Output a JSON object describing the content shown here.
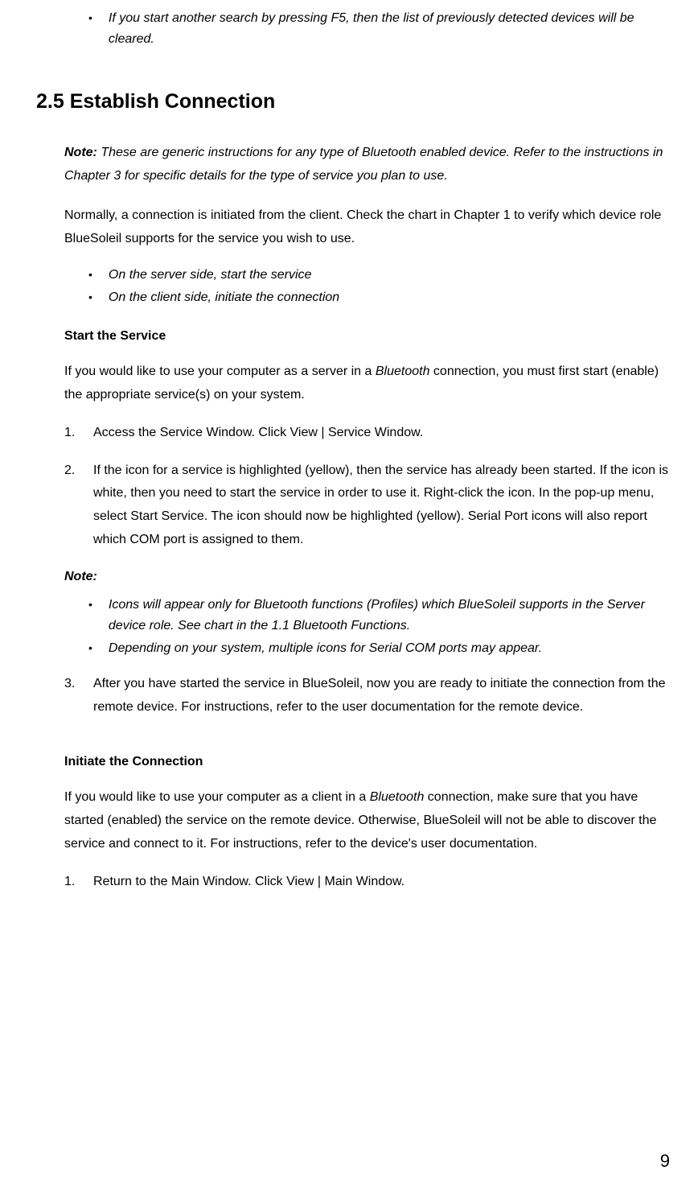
{
  "topBullets": [
    "If you start another search by pressing F5, then the list of previously detected devices will be cleared."
  ],
  "heading": "2.5 Establish Connection",
  "introNoteLabel": "Note:",
  "introNoteText": " These are generic instructions for any type of Bluetooth enabled device. Refer to the instructions in Chapter 3 for specific details for the type of service you plan to use.",
  "para1": "Normally, a connection is initiated from the client. Check the chart in Chapter 1 to verify which device role BlueSoleil supports for the service you wish to use.",
  "subBullets": [
    "On the server side, start the service",
    "On the client side, initiate the connection"
  ],
  "startServiceHeading": "Start the Service",
  "startServicePara_pre": "If you would like to use your computer as a server in a ",
  "startServicePara_italic": "Bluetooth",
  "startServicePara_post": " connection, you must first start (enable) the appropriate service(s) on your system.",
  "step1num": "1.",
  "step1": "Access the Service Window. Click View | Service Window.",
  "step2num": "2.",
  "step2": "If the icon for a service is highlighted (yellow), then the service has already been started. If the icon is white, then you need to start the service in order to use it. Right-click the icon. In the pop-up menu, select Start Service. The icon should now be highlighted (yellow). Serial Port icons will also report which COM port is assigned to them.",
  "noteLabel2": "Note:",
  "noteBullets": [
    "Icons will appear only for Bluetooth functions (Profiles) which BlueSoleil supports in the Server device role. See chart in the 1.1 Bluetooth Functions.",
    "Depending on your system, multiple icons for Serial COM ports may appear."
  ],
  "step3num": "3.",
  "step3": "After you have started the service in BlueSoleil, now you are ready to initiate the connection from the remote device. For instructions, refer to the user documentation for the remote device.",
  "initiateHeading": "Initiate the Connection",
  "initiatePara_pre": "If you would like to use your computer as a client in a ",
  "initiatePara_italic": "Bluetooth",
  "initiatePara_post": " connection, make sure that you have started (enabled) the service on the remote device. Otherwise, BlueSoleil will not be able to discover the service and connect to it. For instructions, refer to the device's user documentation.",
  "initStep1num": "1.",
  "initStep1": "Return to the Main Window. Click View | Main Window.",
  "pageNumber": "9"
}
